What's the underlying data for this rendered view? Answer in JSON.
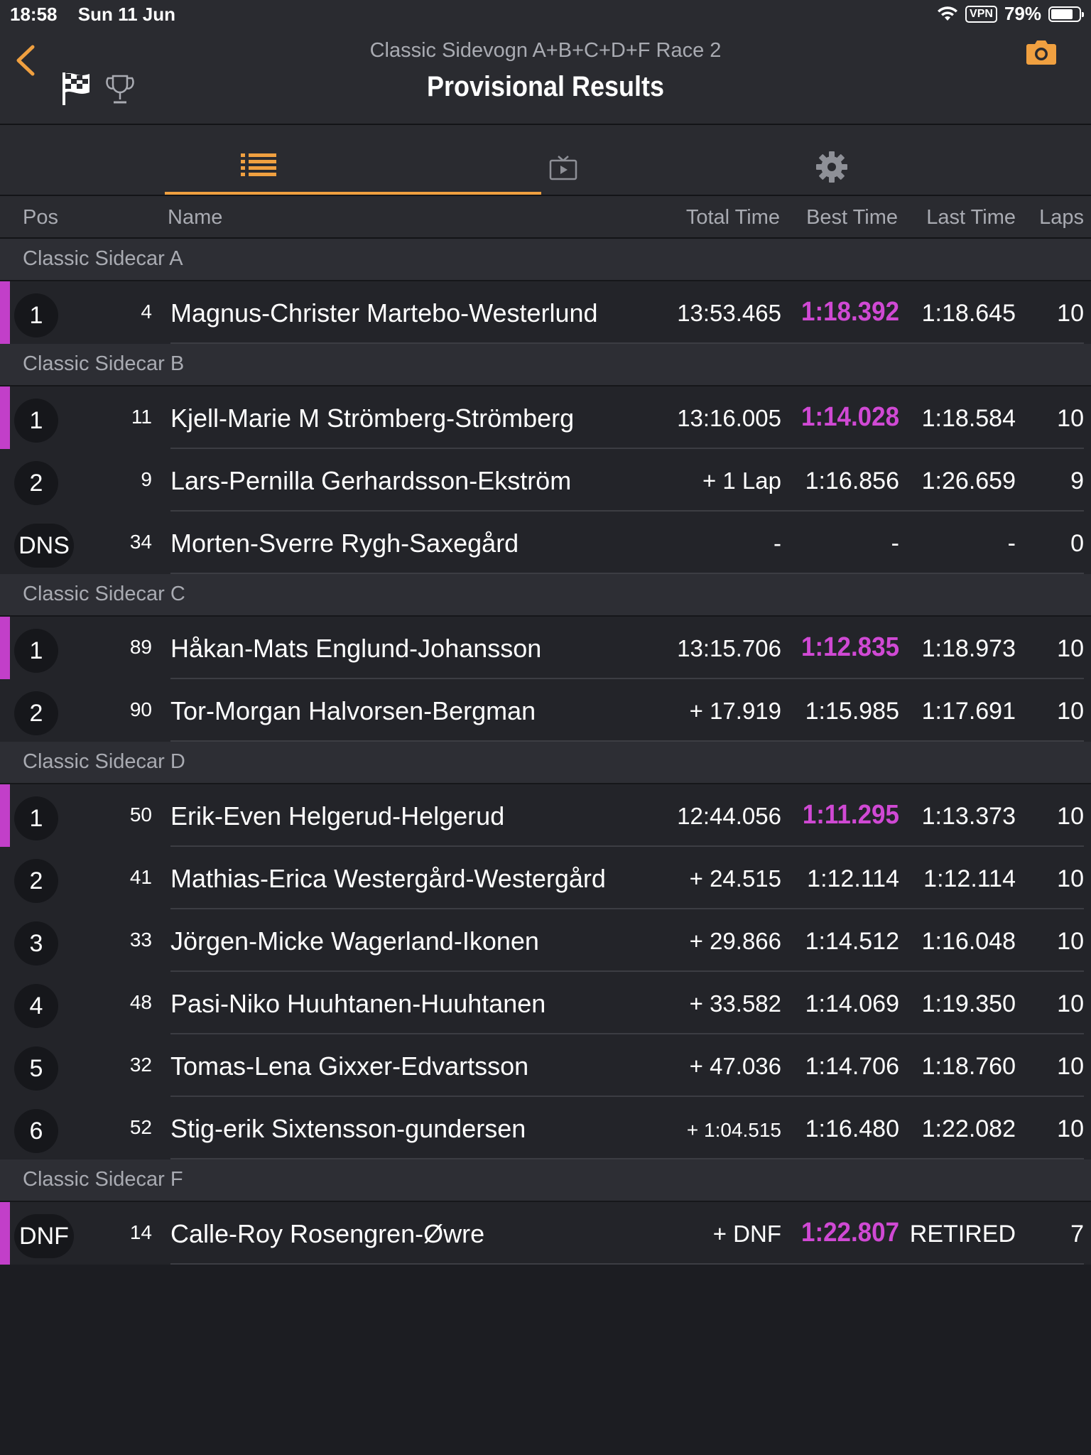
{
  "status_bar": {
    "time": "18:58",
    "date": "Sun 11 Jun",
    "vpn": "VPN",
    "battery": "79%",
    "battery_level": 0.79
  },
  "header": {
    "subtitle": "Classic Sidevogn A+B+C+D+F Race 2",
    "title": "Provisional Results"
  },
  "tabs": [
    {
      "icon": "list-icon",
      "active": true
    },
    {
      "icon": "tv-icon",
      "active": false
    },
    {
      "icon": "gear-icon",
      "active": false
    }
  ],
  "columns": {
    "pos": "Pos",
    "name": "Name",
    "total": "Total Time",
    "best": "Best Time",
    "last": "Last Time",
    "laps": "Laps"
  },
  "accent_colors": {
    "orange": "#f0a040",
    "purple": "#c23fc9"
  },
  "groups": [
    {
      "title": "Classic Sidecar A",
      "rows": [
        {
          "pos": "1",
          "num": "4",
          "name": "Magnus-Christer Martebo-Westerlund",
          "total": "13:53.465",
          "best": "1:18.392",
          "last": "1:18.645",
          "laps": "10",
          "leader": true
        }
      ]
    },
    {
      "title": "Classic Sidecar B",
      "rows": [
        {
          "pos": "1",
          "num": "11",
          "name": "Kjell-Marie M Strömberg-Strömberg",
          "total": "13:16.005",
          "best": "1:14.028",
          "last": "1:18.584",
          "laps": "10",
          "leader": true
        },
        {
          "pos": "2",
          "num": "9",
          "name": "Lars-Pernilla Gerhardsson-Ekström",
          "total": "+ 1 Lap",
          "best": "1:16.856",
          "last": "1:26.659",
          "laps": "9",
          "leader": false
        },
        {
          "pos": "DNS",
          "num": "34",
          "name": "Morten-Sverre Rygh-Saxegård",
          "total": "-",
          "best": "-",
          "last": "-",
          "laps": "0",
          "leader": false
        }
      ]
    },
    {
      "title": "Classic Sidecar C",
      "rows": [
        {
          "pos": "1",
          "num": "89",
          "name": "Håkan-Mats Englund-Johansson",
          "total": "13:15.706",
          "best": "1:12.835",
          "last": "1:18.973",
          "laps": "10",
          "leader": true
        },
        {
          "pos": "2",
          "num": "90",
          "name": "Tor-Morgan Halvorsen-Bergman",
          "total": "+ 17.919",
          "best": "1:15.985",
          "last": "1:17.691",
          "laps": "10",
          "leader": false
        }
      ]
    },
    {
      "title": "Classic Sidecar D",
      "rows": [
        {
          "pos": "1",
          "num": "50",
          "name": "Erik-Even Helgerud-Helgerud",
          "total": "12:44.056",
          "best": "1:11.295",
          "last": "1:13.373",
          "laps": "10",
          "leader": true
        },
        {
          "pos": "2",
          "num": "41",
          "name": "Mathias-Erica Westergård-Westergård",
          "total": "+ 24.515",
          "best": "1:12.114",
          "last": "1:12.114",
          "laps": "10",
          "leader": false
        },
        {
          "pos": "3",
          "num": "33",
          "name": "Jörgen-Micke Wagerland-Ikonen",
          "total": "+ 29.866",
          "best": "1:14.512",
          "last": "1:16.048",
          "laps": "10",
          "leader": false
        },
        {
          "pos": "4",
          "num": "48",
          "name": "Pasi-Niko Huuhtanen-Huuhtanen",
          "total": "+ 33.582",
          "best": "1:14.069",
          "last": "1:19.350",
          "laps": "10",
          "leader": false
        },
        {
          "pos": "5",
          "num": "32",
          "name": "Tomas-Lena Gixxer-Edvartsson",
          "total": "+ 47.036",
          "best": "1:14.706",
          "last": "1:18.760",
          "laps": "10",
          "leader": false
        },
        {
          "pos": "6",
          "num": "52",
          "name": "Stig-erik Sixtensson-gundersen",
          "total": "+ 1:04.515",
          "best": "1:16.480",
          "last": "1:22.082",
          "laps": "10",
          "leader": false,
          "small_total": true
        }
      ]
    },
    {
      "title": "Classic Sidecar F",
      "rows": [
        {
          "pos": "DNF",
          "num": "14",
          "name": "Calle-Roy Rosengren-Øwre",
          "total": "+ DNF",
          "best": "1:22.807",
          "last": "RETIRED",
          "laps": "7",
          "leader": true
        }
      ]
    }
  ]
}
